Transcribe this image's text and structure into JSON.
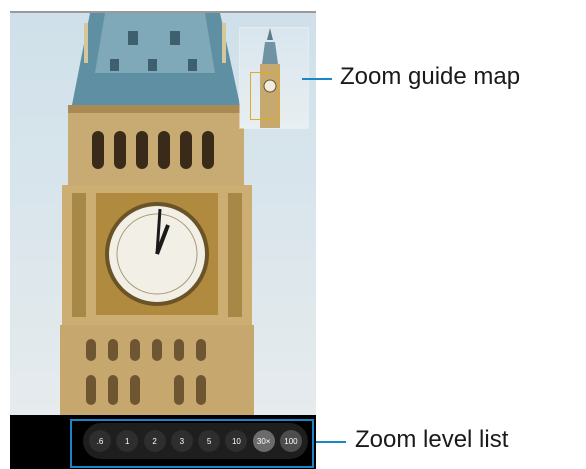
{
  "callouts": {
    "zoom_guide_map": "Zoom guide map",
    "zoom_level_list": "Zoom level list"
  },
  "zoom_levels": [
    ".6",
    "1",
    "2",
    "3",
    "5",
    "10",
    "30×",
    "100"
  ],
  "selected_zoom": "30×",
  "colors": {
    "callout_accent": "#1a86c7",
    "guide_frame": "#e0a92a",
    "bar_background": "#000000"
  }
}
